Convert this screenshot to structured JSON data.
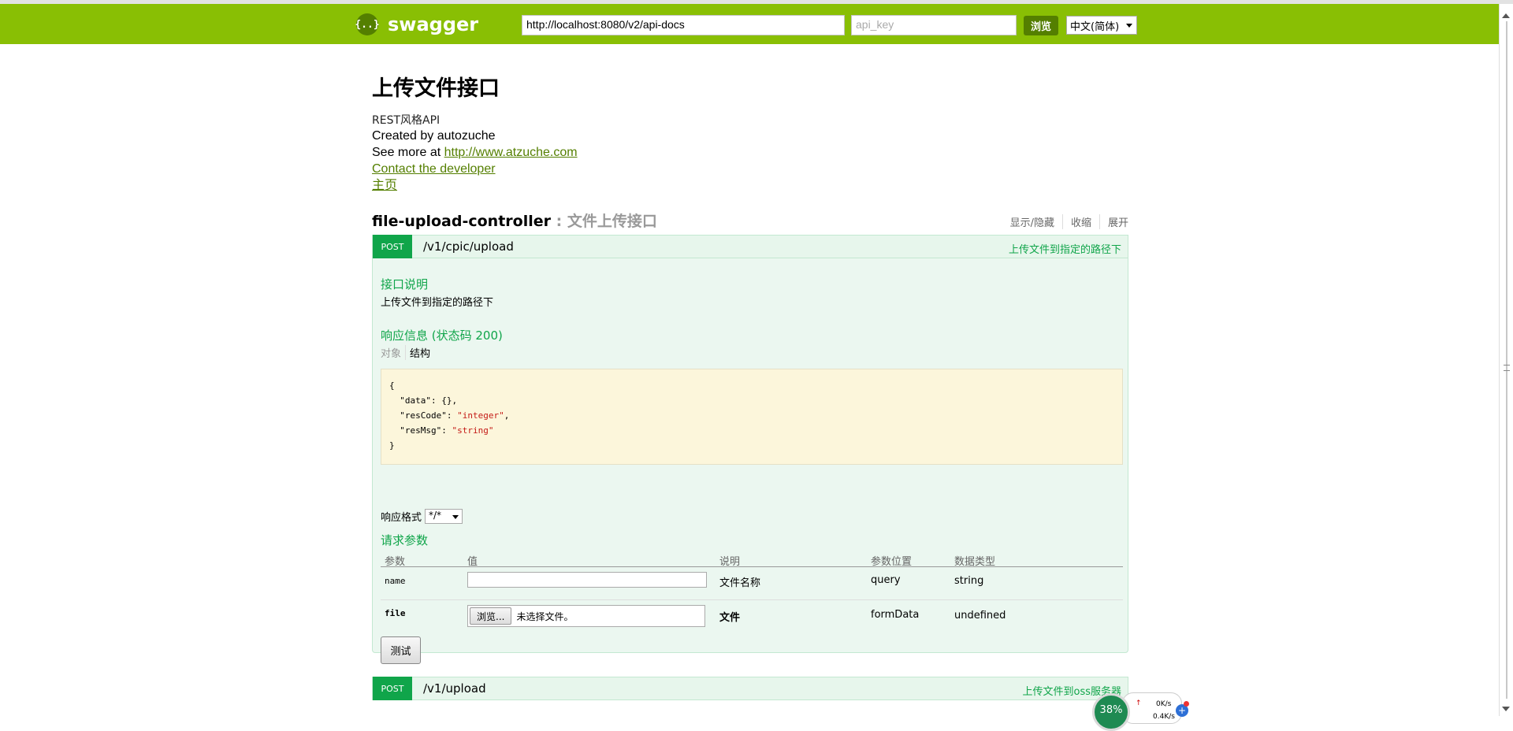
{
  "header": {
    "logo_text": "swagger",
    "logo_glyph": "{..}",
    "url_value": "http://localhost:8080/v2/api-docs",
    "api_key_placeholder": "api_key",
    "explore_label": "浏览",
    "language": "中文(简体)",
    "bg_color": "#89bf04"
  },
  "info": {
    "title": "上传文件接口",
    "description": "REST风格API",
    "created_by": "Created by autozuche",
    "see_more_prefix": "See more at ",
    "see_more_link": "http://www.atzuche.com",
    "contact": "Contact the developer",
    "home": "主页"
  },
  "resource": {
    "name": "file-upload-controller",
    "separator": " : ",
    "description": "文件上传接口",
    "actions": [
      "显示/隐藏",
      "收缩",
      "展开"
    ]
  },
  "operations": [
    {
      "method": "POST",
      "path": "/v1/cpic/upload",
      "summary": "上传文件到指定的路径下",
      "notes_title": "接口说明",
      "notes": "上传文件到指定的路径下",
      "response_title": "响应信息 (状态码 200)",
      "tabs": [
        "对象",
        "结构"
      ],
      "model_lines": [
        "{",
        "  \"data\": {},",
        "  \"resCode\": \"integer\",",
        "  \"resMsg\": \"string\"",
        "}"
      ],
      "content_type_label": "响应格式",
      "content_type_value": "*/*",
      "params_title": "请求参数",
      "param_headers": [
        "参数",
        "值",
        "说明",
        "参数位置",
        "数据类型"
      ],
      "params": [
        {
          "name": "name",
          "value": "",
          "description": "文件名称",
          "location": "query",
          "type": "string"
        },
        {
          "name": "file",
          "file_button": "浏览...",
          "file_status": "未选择文件。",
          "description": "文件",
          "location": "formData",
          "type": "undefined"
        }
      ],
      "try_label": "测试"
    },
    {
      "method": "POST",
      "path": "/v1/upload",
      "summary": "上传文件到oss服务器"
    }
  ],
  "tray_widget": {
    "percent": "38%",
    "up_speed": "0K/s",
    "down_speed": "0.4K/s"
  }
}
